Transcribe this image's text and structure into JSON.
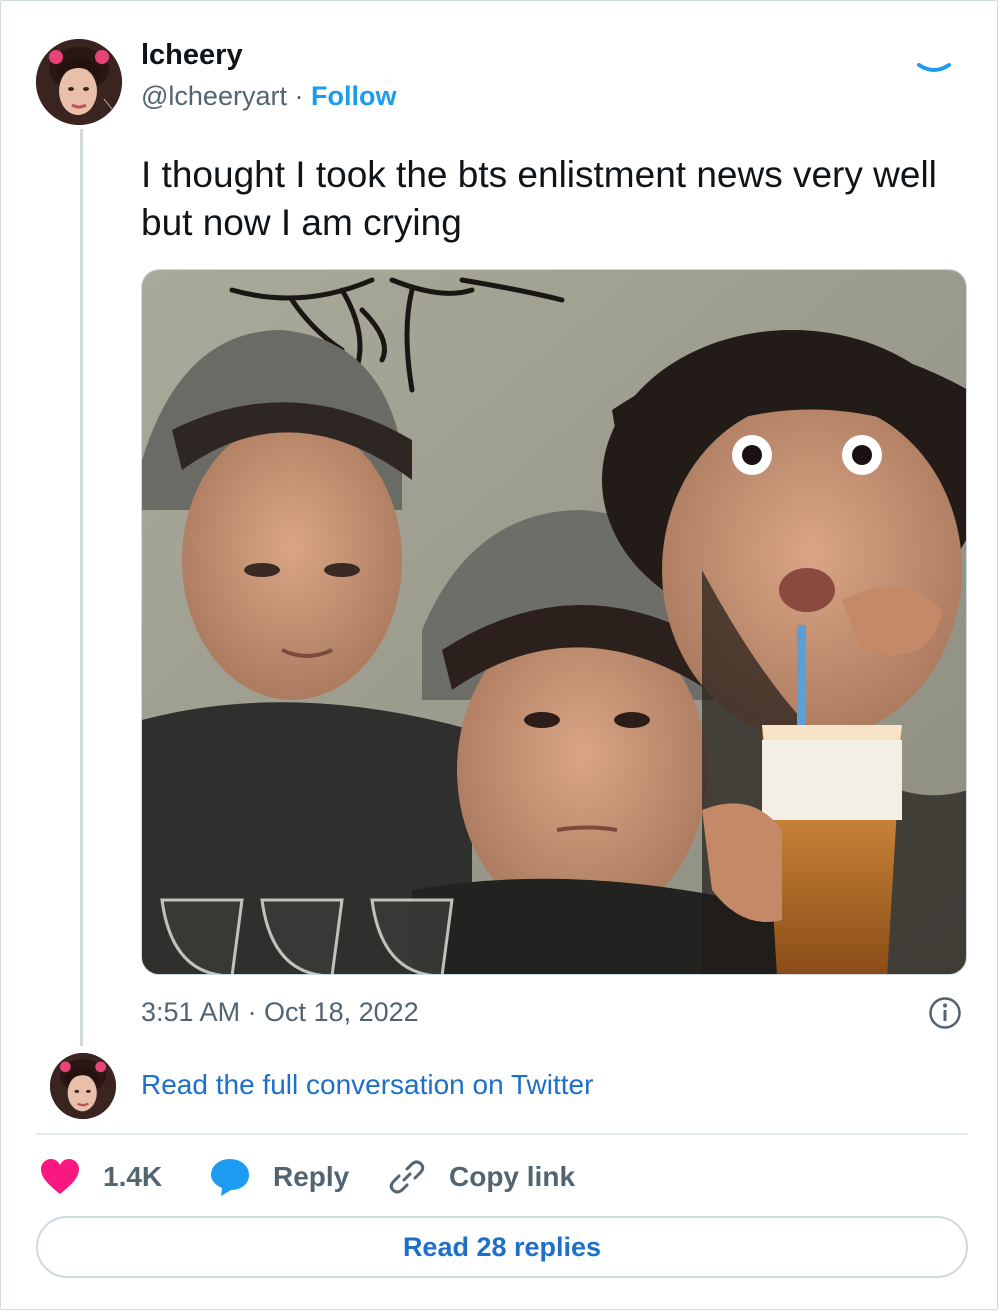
{
  "author": {
    "display_name": "lcheery",
    "handle": "@lcheeryart",
    "separator": "·",
    "follow_label": "Follow"
  },
  "tweet": {
    "text": "I thought I took the bts enlistment news very well but now I am crying",
    "timestamp": "3:51 AM · Oct 18, 2022"
  },
  "conversation_link": "Read the full conversation on Twitter",
  "actions": {
    "like_count": "1.4K",
    "reply_label": "Reply",
    "copy_link_label": "Copy link"
  },
  "read_replies_label": "Read 28 replies",
  "colors": {
    "accent_blue": "#1d9bf0",
    "link_blue": "#1d6fc9",
    "like_pink": "#f91880",
    "secondary_text": "#536471",
    "border": "#cfd9de"
  },
  "icons": {
    "like": "heart-icon",
    "reply": "speech-bubble-icon",
    "copy_link": "link-icon",
    "info": "info-icon"
  }
}
